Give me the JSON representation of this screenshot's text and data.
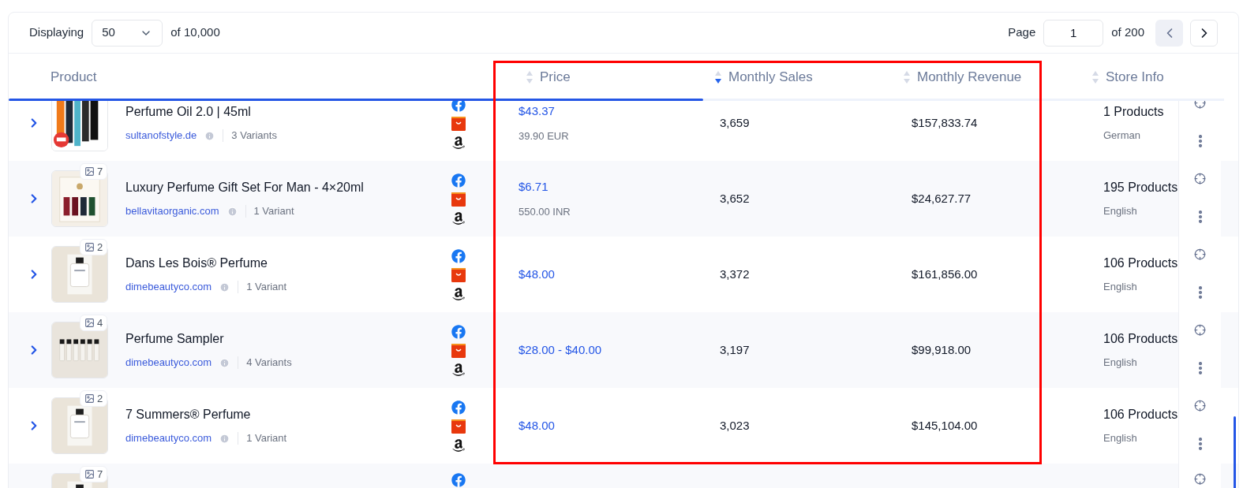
{
  "toolbar": {
    "displaying_label": "Displaying",
    "page_size": "50",
    "total": "of 10,000",
    "page_label": "Page",
    "page": "1",
    "page_total": "of 200",
    "prev_disabled": true
  },
  "columns": [
    {
      "label": "Product",
      "sortable": false
    },
    {
      "label": "Price",
      "sortable": true,
      "sorted": false
    },
    {
      "label": "Monthly Sales",
      "sortable": true,
      "sorted": true
    },
    {
      "label": "Monthly Revenue",
      "sortable": true,
      "sorted": false
    },
    {
      "label": "Store Info",
      "sortable": true,
      "sorted": false
    }
  ],
  "highlight_frame": true,
  "rows": [
    {
      "title": "Perfume Oil 2.0 | 45ml",
      "store": "sultanofstyle.de",
      "variants": "3 Variants",
      "price": "$43.37",
      "price_local": "39.90 EUR",
      "sales": "3,659",
      "revenue": "$157,833.74",
      "products": "1 Products",
      "language": "German"
    },
    {
      "image_count": "7",
      "title": "Luxury Perfume Gift Set For Man - 4×20ml",
      "store": "bellavitaorganic.com",
      "variants": "1 Variant",
      "price": "$6.71",
      "price_local": "550.00 INR",
      "sales": "3,652",
      "revenue": "$24,627.77",
      "products": "195 Products",
      "language": "English"
    },
    {
      "image_count": "2",
      "title": "Dans Les Bois® Perfume",
      "store": "dimebeautyco.com",
      "variants": "1 Variant",
      "price": "$48.00",
      "sales": "3,372",
      "revenue": "$161,856.00",
      "products": "106 Products",
      "language": "English"
    },
    {
      "image_count": "4",
      "title": "Perfume Sampler",
      "store": "dimebeautyco.com",
      "variants": "4 Variants",
      "price": "$28.00 - $40.00",
      "sales": "3,197",
      "revenue": "$99,918.00",
      "products": "106 Products",
      "language": "English"
    },
    {
      "image_count": "2",
      "title": "7 Summers® Perfume",
      "store": "dimebeautyco.com",
      "variants": "1 Variant",
      "price": "$48.00",
      "sales": "3,023",
      "revenue": "$145,104.00",
      "products": "106 Products",
      "language": "English"
    },
    {
      "image_count": "7"
    }
  ]
}
